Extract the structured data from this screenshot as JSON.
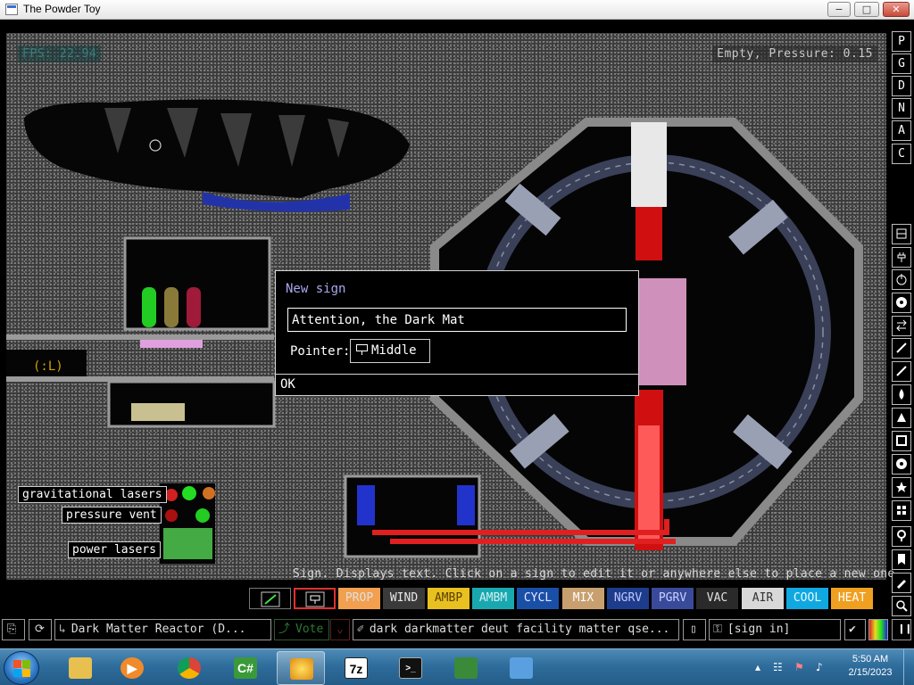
{
  "window": {
    "title": "The Powder Toy"
  },
  "hud": {
    "fps": "FPS: 22.94",
    "pressure": "Empty, Pressure: 0.15",
    "hint": "Sign. Displays text. Click on a sign to edit it or anywhere else to place a new one."
  },
  "signs": [
    {
      "text": "gravitational lasers"
    },
    {
      "text": "pressure vent"
    },
    {
      "text": "power lasers"
    }
  ],
  "dialog": {
    "title": "New sign",
    "input_value": "Attention, the Dark Mat",
    "pointer_label": "Pointer:",
    "pointer_value": "Middle",
    "ok_label": "OK"
  },
  "right_toolbar": {
    "top": [
      "P",
      "G",
      "D",
      "N",
      "A",
      "C"
    ]
  },
  "element_menu": [
    {
      "label": "PROP",
      "bg": "#f2a050",
      "fg": "#e0e0e0"
    },
    {
      "label": "WIND",
      "bg": "#3a3a3a",
      "fg": "#e8e8e8"
    },
    {
      "label": "AMBP",
      "bg": "#e8c020",
      "fg": "#5a4000"
    },
    {
      "label": "AMBM",
      "bg": "#1aa8b0",
      "fg": "#cfeff0"
    },
    {
      "label": "CYCL",
      "bg": "#1a4fa8",
      "fg": "#e8e8ff"
    },
    {
      "label": "MIX",
      "bg": "#c8a070",
      "fg": "#ffffff"
    },
    {
      "label": "NGRV",
      "bg": "#1e3c8c",
      "fg": "#c0c8ff"
    },
    {
      "label": "PGRV",
      "bg": "#3a4a9a",
      "fg": "#c8d0ff"
    },
    {
      "label": "VAC",
      "bg": "#2a2a2a",
      "fg": "#e0e0e0"
    },
    {
      "label": "AIR",
      "bg": "#d8d8d8",
      "fg": "#333333"
    },
    {
      "label": "COOL",
      "bg": "#10a8e0",
      "fg": "#e8f8ff"
    },
    {
      "label": "HEAT",
      "bg": "#f0a020",
      "fg": "#ffffff"
    }
  ],
  "bottom_bar": {
    "save_name": "Dark Matter Reactor (D...",
    "vote_label": "Vote",
    "tags": "dark darkmatter deut facility matter qse...",
    "sign_in": "[sign in]"
  },
  "taskbar": {
    "time": "5:50 AM",
    "date": "2/15/2023",
    "items": [
      "C#",
      "7z"
    ]
  }
}
